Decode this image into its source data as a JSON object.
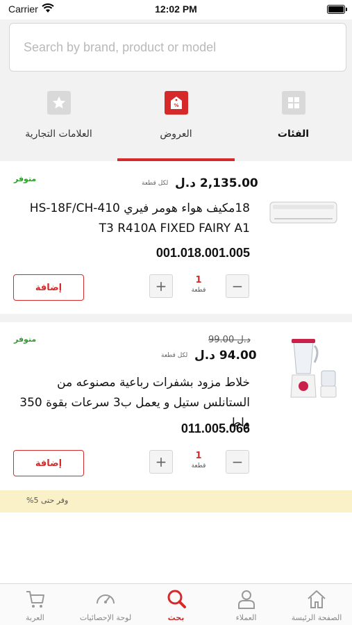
{
  "status": {
    "carrier": "Carrier",
    "time": "12:02 PM"
  },
  "search": {
    "placeholder": "Search by brand, product or model",
    "value": ""
  },
  "tabs": [
    {
      "label": "العلامات التجارية",
      "icon": "star-icon"
    },
    {
      "label": "العروض",
      "icon": "discount-tag-icon",
      "active": true
    },
    {
      "label": "الفئات",
      "icon": "grid-icon"
    }
  ],
  "products": [
    {
      "stock": "متوفر",
      "old_price": "",
      "price": "2,135.00 د.ل",
      "per_unit": "لكل قطعة",
      "title": "18مكيف هواء هومر فيري HS-18F/CH-410 T3 R410A FIXED FAIRY A1",
      "code": "001.018.001.005",
      "add_label": "إضافة",
      "qty": "1",
      "qty_unit": "قطعة",
      "image": "air-conditioner-image"
    },
    {
      "stock": "متوفر",
      "old_price": "99.00 د.ل",
      "price": "94.00 د.ل",
      "per_unit": "لكل قطعة",
      "title": "خلاط مزود بشفرات رباعية مصنوعه من الستانلس ستيل و يعمل ب3 سرعات بقوة 350 واط",
      "code": "011.005.066",
      "add_label": "إضافة",
      "qty": "1",
      "qty_unit": "قطعة",
      "image": "blender-image"
    }
  ],
  "promo": {
    "text": "وفر حتى 5%"
  },
  "tabbar": [
    {
      "label": "العربة",
      "icon": "cart-icon"
    },
    {
      "label": "لوحة الإحصائيات",
      "icon": "dashboard-gauge-icon"
    },
    {
      "label": "بحث",
      "icon": "search-icon",
      "active": true
    },
    {
      "label": "العملاء",
      "icon": "user-icon"
    },
    {
      "label": "الصفحة الرئيسة",
      "icon": "home-icon"
    }
  ],
  "colors": {
    "accent": "#d62a2a",
    "stock_green": "#2e9b2e",
    "promo_bg": "#fbf1c8"
  }
}
